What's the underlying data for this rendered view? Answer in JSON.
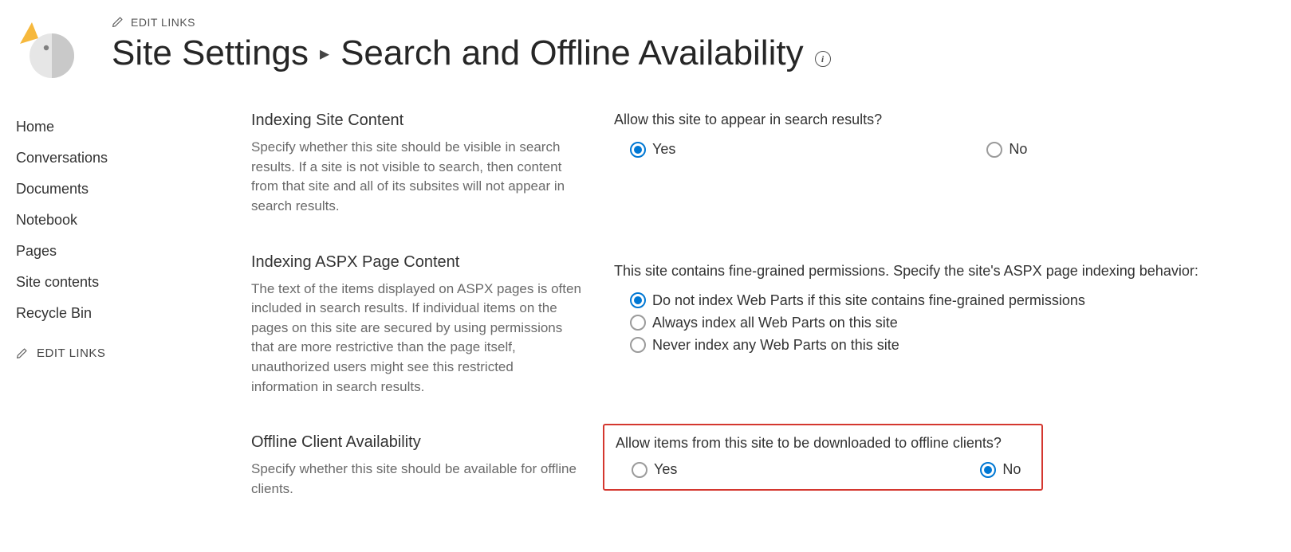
{
  "header": {
    "edit_links": "EDIT LINKS",
    "breadcrumb_parent": "Site Settings",
    "breadcrumb_current": "Search and Offline Availability"
  },
  "sidebar": {
    "items": [
      {
        "label": "Home"
      },
      {
        "label": "Conversations"
      },
      {
        "label": "Documents"
      },
      {
        "label": "Notebook"
      },
      {
        "label": "Pages"
      },
      {
        "label": "Site contents"
      },
      {
        "label": "Recycle Bin"
      }
    ],
    "edit_links": "EDIT LINKS"
  },
  "sections": {
    "indexing_site": {
      "title": "Indexing Site Content",
      "desc": "Specify whether this site should be visible in search results. If a site is not visible to search, then content from that site and all of its subsites will not appear in search results.",
      "question": "Allow this site to appear in search results?",
      "options": {
        "yes": "Yes",
        "no": "No"
      },
      "selected": "yes"
    },
    "indexing_aspx": {
      "title": "Indexing ASPX Page Content",
      "desc": "The text of the items displayed on ASPX pages is often included in search results. If individual items on the pages on this site are secured by using permissions that are more restrictive than the page itself, unauthorized users might see this restricted information in search results.",
      "question": "This site contains fine-grained permissions. Specify the site's ASPX page indexing behavior:",
      "options": [
        {
          "label": "Do not index Web Parts if this site contains fine-grained permissions",
          "selected": true
        },
        {
          "label": "Always index all Web Parts on this site",
          "selected": false
        },
        {
          "label": "Never index any Web Parts on this site",
          "selected": false
        }
      ]
    },
    "offline": {
      "title": "Offline Client Availability",
      "desc": "Specify whether this site should be available for offline clients.",
      "question": "Allow items from this site to be downloaded to offline clients?",
      "options": {
        "yes": "Yes",
        "no": "No"
      },
      "selected": "no"
    }
  }
}
